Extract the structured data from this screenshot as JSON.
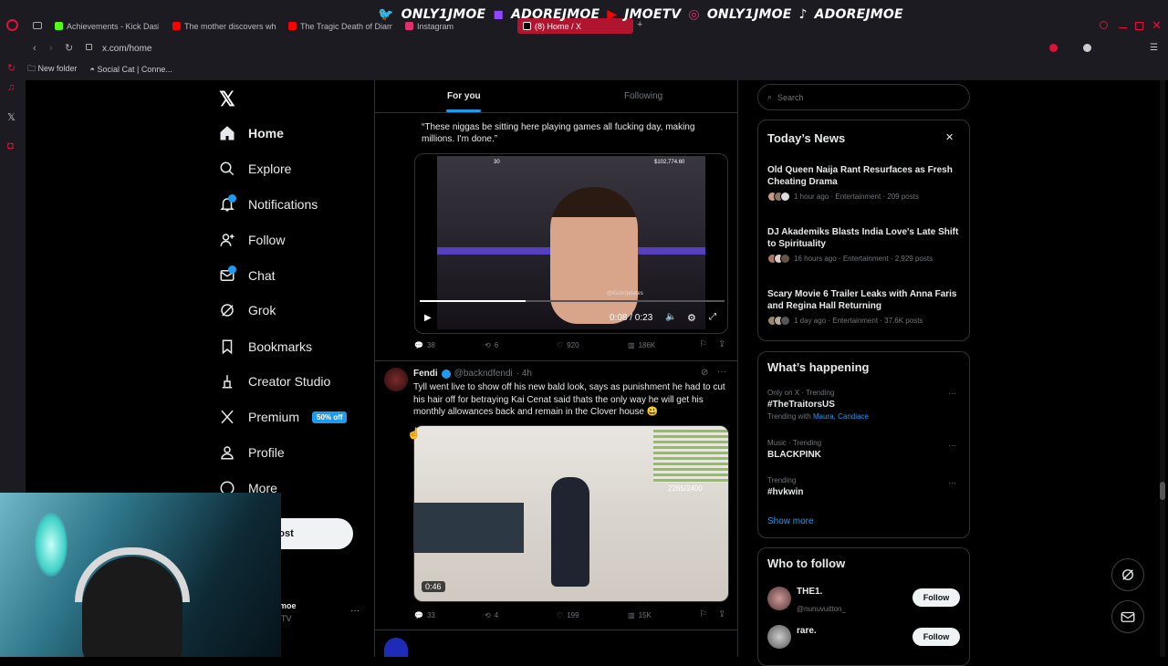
{
  "banner": {
    "items": [
      {
        "icon": "twitter-icon",
        "label": "ONLY1JMOE"
      },
      {
        "icon": "twitch-icon",
        "label": "ADOREJMOE"
      },
      {
        "icon": "youtube-icon",
        "label": "JMOETV"
      },
      {
        "icon": "instagram-icon",
        "label": "ONLY1JMOE"
      },
      {
        "icon": "tiktok-icon",
        "label": "ADOREJMOE"
      }
    ]
  },
  "browser": {
    "tabs": [
      {
        "label": "Achievements - Kick Dash",
        "color": "#53fc18"
      },
      {
        "label": "The mother discovers wha",
        "color": "#ff0000"
      },
      {
        "label": "The Tragic Death of Diam",
        "color": "#ff0000"
      },
      {
        "label": "Instagram",
        "color": "#e1306c"
      },
      {
        "label": "(8) Home / X",
        "color": "#000000"
      }
    ],
    "new_tab": "+",
    "url": "x.com/home",
    "bookmarks": [
      {
        "label": "New folder"
      },
      {
        "label": "Social Cat | Conne..."
      }
    ]
  },
  "nav": {
    "items": [
      {
        "label": "Home",
        "icon": "home-icon"
      },
      {
        "label": "Explore",
        "icon": "search-icon"
      },
      {
        "label": "Notifications",
        "icon": "bell-icon"
      },
      {
        "label": "Follow",
        "icon": "add-user-icon"
      },
      {
        "label": "Chat",
        "icon": "chat-icon"
      },
      {
        "label": "Grok",
        "icon": "grok-icon"
      },
      {
        "label": "Bookmarks",
        "icon": "bookmark-icon"
      },
      {
        "label": "Creator Studio",
        "icon": "creator-icon"
      },
      {
        "label": "Premium",
        "icon": "x-logo-icon"
      },
      {
        "label": "Profile",
        "icon": "person-icon"
      },
      {
        "label": "More",
        "icon": "more-circle-icon"
      }
    ],
    "premium_badge": "50% off",
    "post_label": "ost",
    "profile_name": "moe",
    "profile_handle": "TV",
    "profile_more": "···",
    "colors": {
      "accent": "#1d9bf0",
      "background": "#000000"
    }
  },
  "feed": {
    "tabs": [
      {
        "label": "For you",
        "active": true
      },
      {
        "label": "Following",
        "active": false
      }
    ],
    "tweet1": {
      "text": "“These niggas be sitting here playing games all fucking day, making millions. I'm done.”",
      "video_time": "0:08 / 0:23",
      "video_overlay_left": "30",
      "video_overlay_right": "$102,774.60",
      "watermark": "@KickUpdates",
      "stats": {
        "replies": "38",
        "reposts": "6",
        "likes": "920",
        "views": "186K"
      }
    },
    "tweet2": {
      "name": "Fendi",
      "handle": "@backndfendi",
      "time": "· 4h",
      "text": "Tyll went live to show off his new bald look, says as punishment he had to cut his hair off for betraying Kai Cenat said thats the only way he will get his monthly allowances back and remain in the Clover house 😃",
      "video_duration": "0:46",
      "overlay_count": "2265/2400",
      "stats": {
        "replies": "33",
        "reposts": "4",
        "likes": "199",
        "views": "15K"
      }
    }
  },
  "right": {
    "search_placeholder": "Search",
    "news_title": "Today’s News",
    "news": [
      {
        "title": "Old Queen Naija Rant Resurfaces as Fresh Cheating Drama",
        "meta": "1 hour ago · Entertainment · 209 posts"
      },
      {
        "title": "DJ Akademiks Blasts India Love's Late Shift to Spirituality",
        "meta": "16 hours ago · Entertainment · 2,929 posts"
      },
      {
        "title": "Scary Movie 6 Trailer Leaks with Anna Faris and Regina Hall Returning",
        "meta": "1 day ago · Entertainment · 37.6K posts"
      }
    ],
    "happening_title": "What’s happening",
    "trends": [
      {
        "context": "Only on X · Trending",
        "name": "#TheTraitorsUS",
        "extra_prefix": "Trending with",
        "extra": "Maura, Candiace"
      },
      {
        "context": "Music · Trending",
        "name": "BLACKPINK"
      },
      {
        "context": "Trending",
        "name": "#hvkwin"
      }
    ],
    "show_more": "Show more",
    "who_title": "Who to follow",
    "follows": [
      {
        "name": "THE1.",
        "handle": "@nunuvuitton_",
        "button": "Follow"
      },
      {
        "name": "rare.",
        "handle": "",
        "button": "Follow"
      }
    ]
  }
}
